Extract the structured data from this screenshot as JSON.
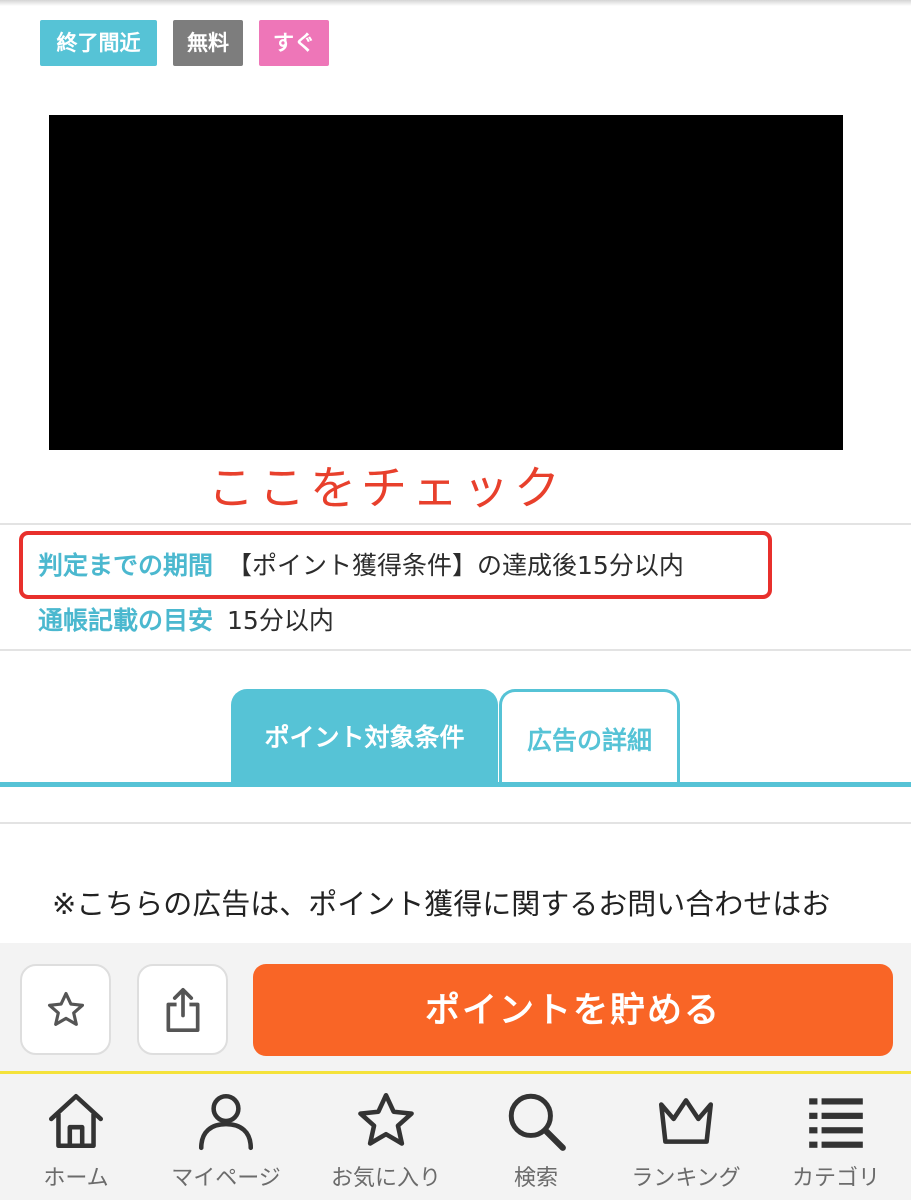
{
  "badges": {
    "ending": "終了間近",
    "free": "無料",
    "instant": "すぐ"
  },
  "annotation": "ここをチェック",
  "info": {
    "judge_label": "判定までの期間",
    "judge_value": "【ポイント獲得条件】の達成後15分以内",
    "bankbook_label": "通帳記載の目安",
    "bankbook_value": "15分以内"
  },
  "tabs": {
    "conditions": "ポイント対象条件",
    "details": "広告の詳細"
  },
  "notice": "※こちらの広告は、ポイント獲得に関するお問い合わせはお",
  "actions": {
    "favorite_icon": "star-icon",
    "share_icon": "share-icon",
    "cta_label": "ポイントを貯める"
  },
  "nav": {
    "home": "ホーム",
    "mypage": "マイページ",
    "favorites": "お気に入り",
    "search": "検索",
    "ranking": "ランキング",
    "category": "カテゴリ"
  },
  "colors": {
    "accent": "#56c3d6",
    "cta": "#f96526",
    "annotation": "#e8402c",
    "badge_ending": "#56c3d6",
    "badge_free": "#7d7d7d",
    "badge_instant": "#ee76b8"
  }
}
